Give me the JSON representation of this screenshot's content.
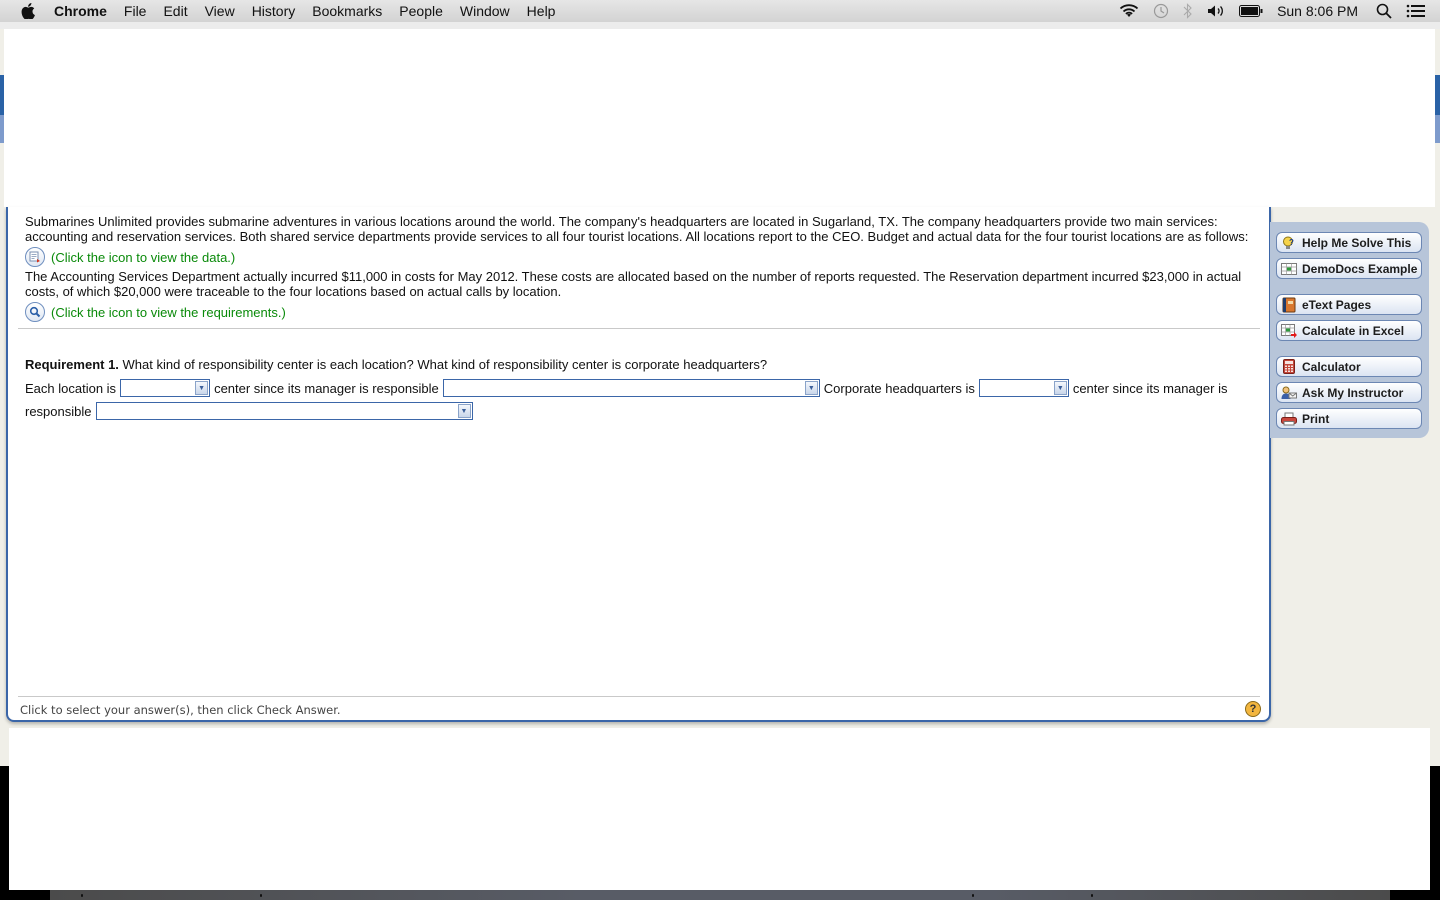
{
  "menubar": {
    "apple_icon": "apple-logo-icon",
    "app_name": "Chrome",
    "items": [
      "File",
      "Edit",
      "View",
      "History",
      "Bookmarks",
      "People",
      "Window",
      "Help"
    ],
    "status_icons": [
      "wifi-icon",
      "time-machine-icon",
      "bluetooth-icon",
      "volume-icon",
      "battery-icon"
    ],
    "clock": "Sun 8:06 PM",
    "right_icons": [
      "spotlight-search-icon",
      "notification-center-icon"
    ]
  },
  "question": {
    "paragraph1": "Submarines Unlimited provides submarine adventures in various locations around the world. The company's headquarters are located in Sugarland, TX. The company headquarters provide two main services: accounting and reservation services. Both shared service departments provide services to all four tourist locations. All locations report to the CEO. Budget and actual data for the four tourist locations are as follows:",
    "data_link": "(Click the icon to view the data.)",
    "paragraph2": "The Accounting Services Department actually incurred $11,000 in costs for May 2012. These costs are allocated based on the number of reports requested. The Reservation department incurred $23,000 in actual costs, of which $20,000 were traceable to the four locations based on actual calls by location.",
    "requirements_link": "(Click the icon to view the requirements.)",
    "requirement_label": "Requirement 1.",
    "requirement_text": " What kind of responsibility center is each location? What kind of responsibility center is corporate headquarters?",
    "answer": {
      "t1": "Each location is",
      "t2": "center since its manager is responsible",
      "t3": "Corporate headquarters is",
      "t4": "center since its manager is",
      "t5": "responsible",
      "dropdowns": [
        {
          "selected": ""
        },
        {
          "selected": ""
        },
        {
          "selected": ""
        },
        {
          "selected": ""
        }
      ]
    },
    "footer_instruction": "Click to select your answer(s), then click Check Answer.",
    "help_symbol": "?"
  },
  "tools": [
    {
      "label": "Help Me Solve This",
      "icon": "lightbulb-question-icon"
    },
    {
      "label": "DemoDocs Example",
      "icon": "spreadsheet-icon"
    },
    {
      "label": "eText Pages",
      "icon": "book-icon"
    },
    {
      "label": "Calculate in Excel",
      "icon": "excel-arrow-icon"
    },
    {
      "label": "Calculator",
      "icon": "calculator-icon"
    },
    {
      "label": "Ask My Instructor",
      "icon": "instructor-mail-icon"
    },
    {
      "label": "Print",
      "icon": "printer-icon"
    }
  ],
  "colors": {
    "link_green": "#0a8a0a",
    "panel_border_blue": "#3b66a8",
    "tool_panel_bg": "#b7c5d9",
    "help_orange": "#f3b63f"
  }
}
